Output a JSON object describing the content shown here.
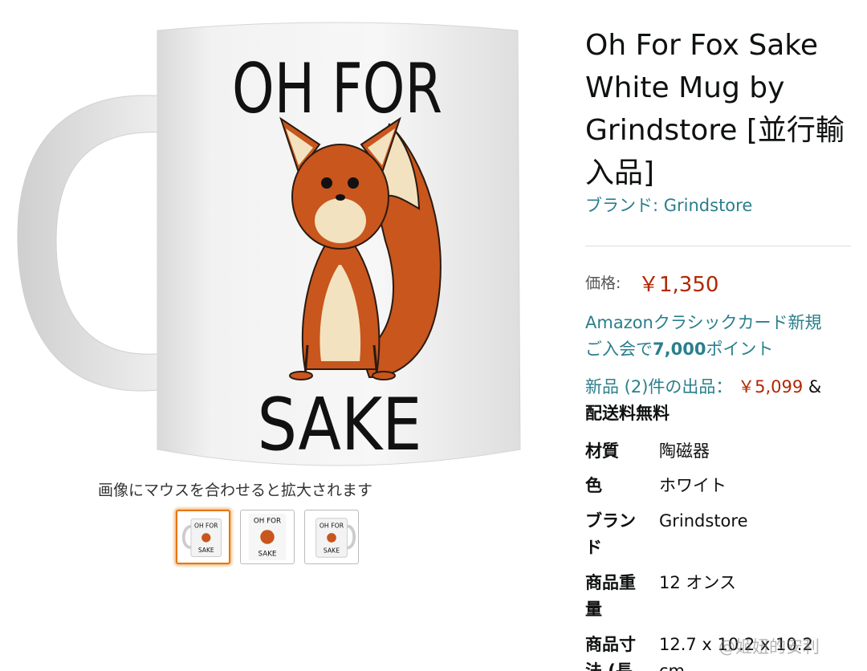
{
  "product": {
    "title": "Oh For Fox Sake White Mug by Grindstore [並行輸入品]",
    "brand_link": "ブランド: Grindstore",
    "mug_text_top": "OH FOR",
    "mug_text_bottom": "SAKE",
    "image_hint": "画像にマウスを合わせると拡大されます",
    "thumbnails": [
      {
        "name": "thumb-1",
        "selected": true
      },
      {
        "name": "thumb-2",
        "selected": false
      },
      {
        "name": "thumb-3",
        "selected": false
      }
    ]
  },
  "price": {
    "label": "価格:",
    "value": "￥1,350"
  },
  "promo": {
    "line1": "Amazonクラシックカード新規",
    "line2_prefix": "ご入会で",
    "line2_points": "7,000",
    "line2_suffix": "ポイント"
  },
  "offers": {
    "link_text": "新品 (2)件の出品：",
    "price": "￥5,099",
    "amp": "&",
    "shipping": "配送料無料"
  },
  "specs": [
    {
      "key": "材質",
      "value": "陶磁器"
    },
    {
      "key": "色",
      "value": "ホワイト"
    },
    {
      "key": "ブランド",
      "value": "Grindstore"
    },
    {
      "key": "商品重量",
      "value": "12 オンス"
    },
    {
      "key": "商品寸法 (長",
      "value": "12.7 x 10.2 x 10.2 cm"
    }
  ],
  "watermark": "@姬妞的安利",
  "colors": {
    "accent_link": "#2a7f8c",
    "price": "#b12704",
    "selected_thumb": "#e77600",
    "fox": "#c8561d"
  }
}
